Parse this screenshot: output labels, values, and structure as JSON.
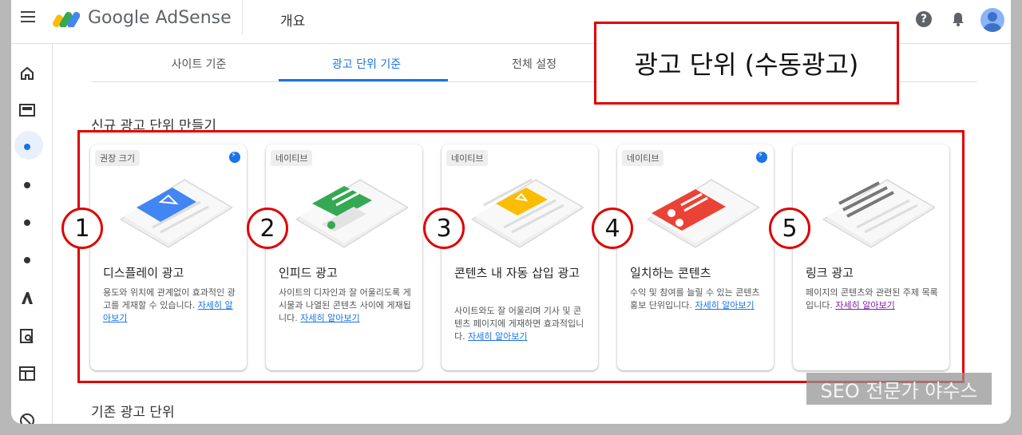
{
  "header": {
    "brand": "Google AdSense",
    "page_title": "개요"
  },
  "tabs": [
    {
      "label": "사이트 기준",
      "active": false
    },
    {
      "label": "광고 단위 기준",
      "active": true
    },
    {
      "label": "전체 설정",
      "active": false
    }
  ],
  "callout": "광고 단위 (수동광고)",
  "section_new": "신규 광고 단위 만들기",
  "section_existing": "기존 광고 단위",
  "cards": [
    {
      "number": "1",
      "chip": "권장 크기",
      "boost": true,
      "title": "디스플레이 광고",
      "desc": "용도와 위치에 관계없이 효과적인 광고를 게재할 수 있습니다.",
      "link": "자세히 알아보기"
    },
    {
      "number": "2",
      "chip": "네이티브",
      "boost": false,
      "title": "인피드 광고",
      "desc": "사이트의 디자인과 잘 어울리도록 게시물과 나열된 콘텐츠 사이에 게재됩니다.",
      "link": "자세히 알아보기"
    },
    {
      "number": "3",
      "chip": "네이티브",
      "boost": false,
      "title": "콘텐츠 내 자동 삽입 광고",
      "desc": "사이트와도 잘 어울리며 기사 및 콘텐츠 페이지에 게재하면 효과적입니다.",
      "link": "자세히 알아보기"
    },
    {
      "number": "4",
      "chip": "네이티브",
      "boost": true,
      "title": "일치하는 콘텐츠",
      "desc": "수익 및 참여를 늘릴 수 있는 콘텐츠 홍보 단위입니다.",
      "link": "자세히 알아보기"
    },
    {
      "number": "5",
      "chip": "",
      "boost": false,
      "title": "링크 광고",
      "desc": "페이지의 콘텐츠와 관련된 주제 목록입니다.",
      "link": "자세히 알아보기"
    }
  ],
  "watermark": "SEO 전문가 야수스",
  "colors": {
    "accent": "#1a73e8",
    "highlight_red": "#e00000"
  },
  "icons": {
    "sidebar": [
      "home-icon",
      "ads-icon",
      "dot-icon",
      "dot-icon",
      "dot-icon",
      "dot-icon",
      "adsense-logo-icon",
      "search-report-icon",
      "layout-icon",
      "block-icon"
    ],
    "header": [
      "menu-icon",
      "help-icon",
      "bell-icon",
      "avatar"
    ]
  }
}
